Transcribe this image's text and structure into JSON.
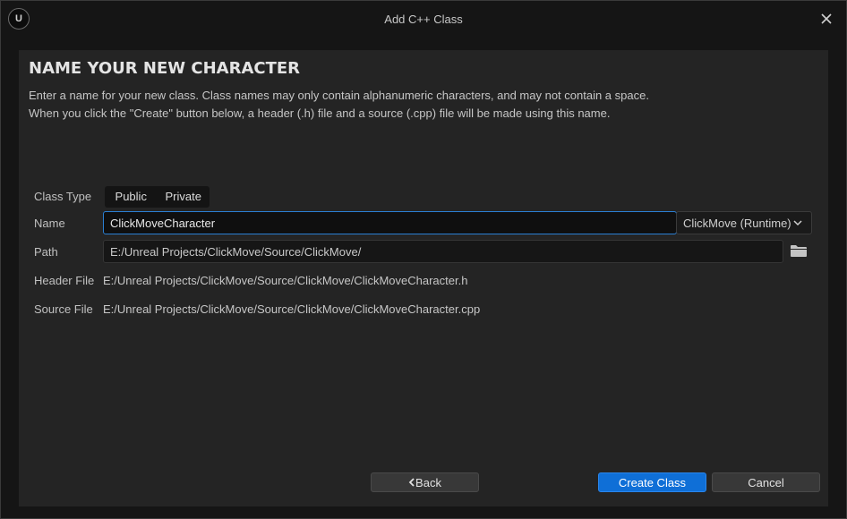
{
  "window": {
    "title": "Add C++ Class",
    "logo_text": "U"
  },
  "dialog": {
    "heading": "NAME YOUR NEW CHARACTER",
    "description_line1": "Enter a name for your new class. Class names may only contain alphanumeric characters, and may not contain a space.",
    "description_line2": "When you click the \"Create\" button below, a header (.h) file and a source (.cpp) file will be made using this name."
  },
  "form": {
    "class_type_label": "Class Type",
    "class_type_options": [
      "Public",
      "Private"
    ],
    "name_label": "Name",
    "name_value": "ClickMoveCharacter",
    "module_selected": "ClickMove (Runtime)",
    "path_label": "Path",
    "path_value": "E:/Unreal Projects/ClickMove/Source/ClickMove/",
    "header_file_label": "Header File",
    "header_file_value": "E:/Unreal Projects/ClickMove/Source/ClickMove/ClickMoveCharacter.h",
    "source_file_label": "Source File",
    "source_file_value": "E:/Unreal Projects/ClickMove/Source/ClickMove/ClickMoveCharacter.cpp"
  },
  "buttons": {
    "back": "Back",
    "create": "Create Class",
    "cancel": "Cancel"
  },
  "icons": {
    "logo": "unreal-logo-icon",
    "close": "close-icon",
    "dropdown": "chevron-down-icon",
    "folder": "folder-icon",
    "back": "chevron-left-icon"
  },
  "colors": {
    "accent": "#0f6fd7",
    "focus_border": "#2a7fd4",
    "panel": "#242424",
    "background": "#151515"
  }
}
